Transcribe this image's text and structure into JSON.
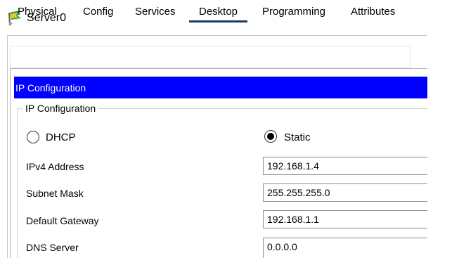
{
  "window": {
    "title": "Server0",
    "icon": "server-flag-icon"
  },
  "tabs": [
    {
      "label": "Physical",
      "active": false
    },
    {
      "label": "Config",
      "active": false
    },
    {
      "label": "Services",
      "active": false
    },
    {
      "label": "Desktop",
      "active": true
    },
    {
      "label": "Programming",
      "active": false
    },
    {
      "label": "Attributes",
      "active": false
    }
  ],
  "panel": {
    "header": "IP Configuration",
    "header_bg": "#0000ff",
    "group_title": "IP Configuration"
  },
  "mode": {
    "dhcp_label": "DHCP",
    "static_label": "Static",
    "selected": "Static"
  },
  "fields": {
    "ipv4": {
      "label": "IPv4 Address",
      "value": "192.168.1.4"
    },
    "subnet": {
      "label": "Subnet Mask",
      "value": "255.255.255.0"
    },
    "gateway": {
      "label": "Default Gateway",
      "value": "192.168.1.1"
    },
    "dns": {
      "label": "DNS Server",
      "value": "0.0.0.0"
    }
  }
}
